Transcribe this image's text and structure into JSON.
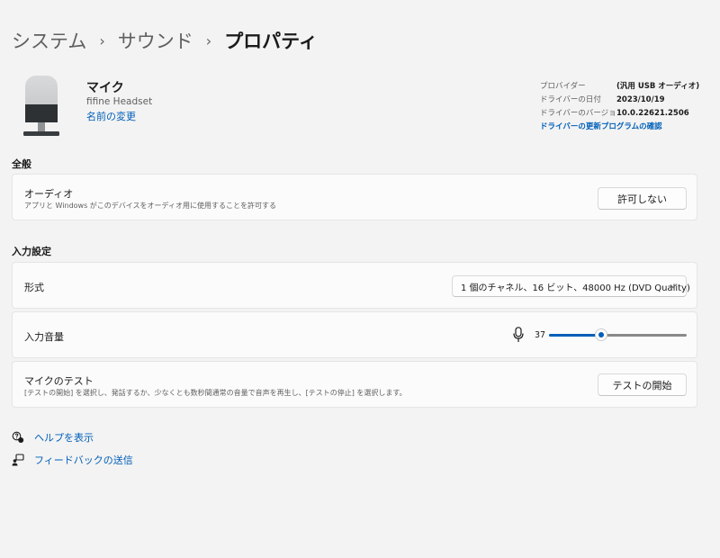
{
  "breadcrumb": {
    "items": [
      "システム",
      "サウンド"
    ],
    "separator": "›",
    "current": "プロパティ"
  },
  "device": {
    "icon": "microphone-device-icon",
    "title": "マイク",
    "subtitle": "fifine Headset",
    "rename_link": "名前の変更"
  },
  "driver_info": {
    "rows": [
      {
        "label": "プロバイダー",
        "value": "(汎用 USB オーディオ)"
      },
      {
        "label": "ドライバーの日付",
        "value": "2023/10/19"
      },
      {
        "label": "ドライバーのバージョン",
        "value": "10.0.22621.2506"
      }
    ],
    "update_link": "ドライバーの更新プログラムの確認"
  },
  "general": {
    "section_title": "全般",
    "audio": {
      "title": "オーディオ",
      "description": "アプリと Windows がこのデバイスをオーディオ用に使用することを許可する",
      "button": "許可しない"
    }
  },
  "input_settings": {
    "section_title": "入力設定",
    "format": {
      "title": "形式",
      "selected": "1 個のチャネル、16 ビット、48000 Hz (DVD Quality)"
    },
    "volume": {
      "title": "入力音量",
      "icon": "microphone-icon",
      "value": "37",
      "level_percent": 37
    },
    "mic_test": {
      "title": "マイクのテスト",
      "description": "[テストの開始] を選択し、発話するか、少なくとも数秒間通常の音量で音声を再生し、[テストの停止] を選択します。",
      "button": "テストの開始"
    }
  },
  "links": [
    {
      "icon": "help-icon",
      "label": "ヘルプを表示"
    },
    {
      "icon": "feedback-icon",
      "label": "フィードバックの送信"
    }
  ],
  "colors": {
    "accent": "#005fb8",
    "background": "#f3f3f3",
    "card": "#fbfbfb"
  }
}
